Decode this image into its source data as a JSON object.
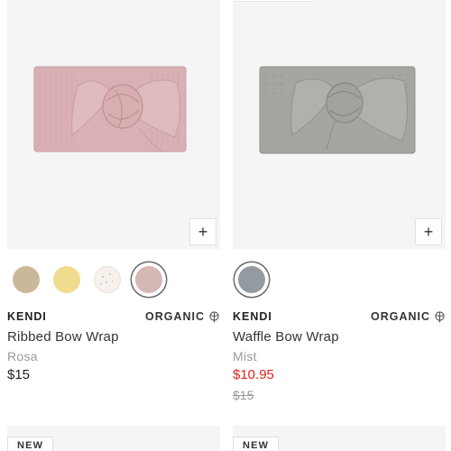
{
  "products": [
    {
      "brand": "KENDI",
      "badge": "ORGANIC",
      "title": "Ribbed Bow Wrap",
      "variant": "Rosa",
      "price": "$15",
      "add_label": "+",
      "swatch_colors": [
        "#cbb89a",
        "#f1dc8e",
        "#f6f1ec",
        "#d3b8b4"
      ],
      "selected_swatch": 3,
      "image_color": "#d7afb1"
    },
    {
      "brand": "KENDI",
      "badge": "ORGANIC",
      "title": "Waffle Bow Wrap",
      "variant": "Mist",
      "price": "$10.95",
      "original_price": "$15",
      "add_label": "+",
      "swatch_colors": [
        "#939ba1"
      ],
      "selected_swatch": 0,
      "image_color": "#a1a4a0"
    }
  ],
  "next_row": [
    {
      "badge": "NEW"
    },
    {
      "badge": "NEW"
    }
  ],
  "colors": {
    "sale_price": "#e0241b"
  }
}
